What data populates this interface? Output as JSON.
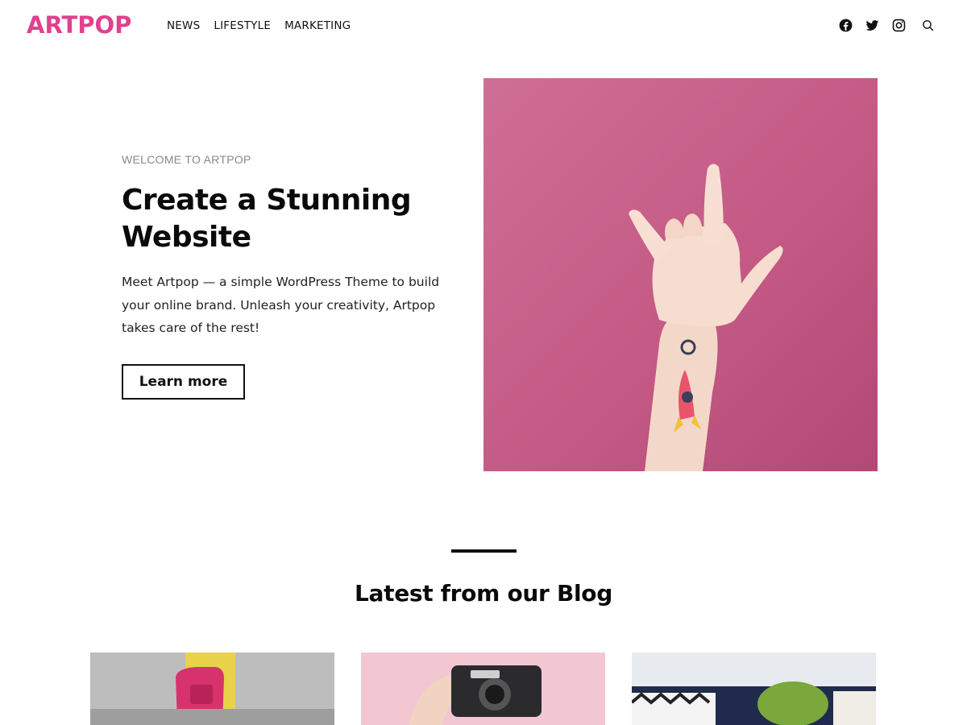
{
  "header": {
    "logo": "ARTPOP",
    "nav": [
      "NEWS",
      "LIFESTYLE",
      "MARKETING"
    ],
    "social_icons": [
      "facebook-icon",
      "twitter-icon",
      "instagram-icon",
      "search-icon"
    ]
  },
  "hero": {
    "eyebrow": "WELCOME TO ARTPOP",
    "title": "Create a Stunning Website",
    "text": "Meet Artpop — a simple WordPress Theme to build your online brand.  Unleash your creativity, Artpop takes care of the rest!",
    "button": "Learn more",
    "image_color": "#c96a91"
  },
  "blog": {
    "title": "Latest from our Blog"
  },
  "colors": {
    "brand": "#e0418d",
    "text": "#111111"
  }
}
